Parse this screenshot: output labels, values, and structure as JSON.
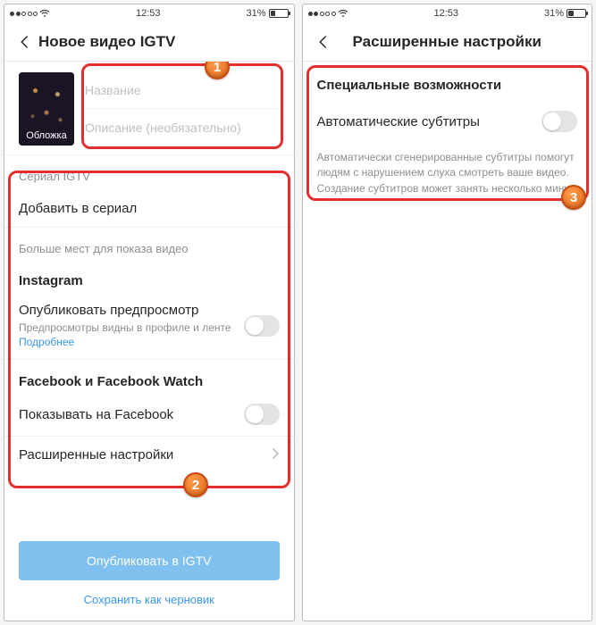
{
  "status": {
    "time": "12:53",
    "battery_pct": "31%",
    "battery_fill_width": "31%"
  },
  "left": {
    "title": "Новое видео IGTV",
    "cover_label": "Обложка",
    "title_placeholder": "Название",
    "desc_placeholder": "Описание (необязательно)",
    "serial_label": "Сериал IGTV",
    "add_serial": "Добавить в сериал",
    "more_places": "Больше мест для показа видео",
    "ig_label": "Instagram",
    "preview_label": "Опубликовать предпросмотр",
    "preview_sub": "Предпросмотры видны в профиле и ленте",
    "more_link": "Подробнее",
    "fbw_label": "Facebook и Facebook Watch",
    "show_fb": "Показывать на Facebook",
    "adv_settings": "Расширенные настройки",
    "publish": "Опубликовать в IGTV",
    "draft": "Сохранить как черновик"
  },
  "right": {
    "title": "Расширенные настройки",
    "section": "Специальные возможности",
    "auto_sub": "Автоматические субтитры",
    "help": "Автоматически сгенерированные субтитры помогут людям с нарушением слуха смотреть ваше видео. Создание субтитров может занять несколько минут."
  },
  "badges": {
    "b1": "1",
    "b2": "2",
    "b3": "3"
  }
}
